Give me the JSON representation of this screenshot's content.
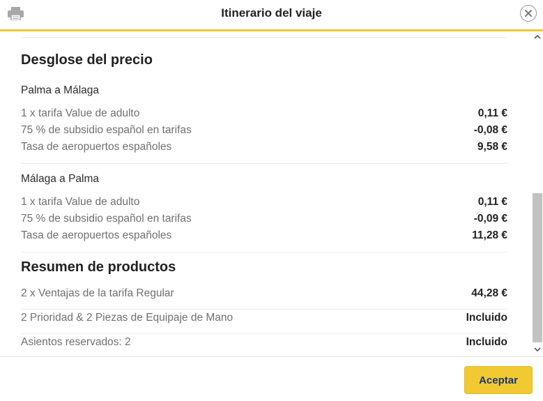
{
  "header": {
    "title": "Itinerario del viaje",
    "print_icon": "printer-icon",
    "close_icon": "close-icon"
  },
  "price_breakdown": {
    "heading": "Desglose del precio",
    "segments": [
      {
        "route": "Palma a Málaga",
        "lines": [
          {
            "label": "1 x tarifa Value de adulto",
            "amount": "0,11 €"
          },
          {
            "label": "75 % de subsidio español en tarifas",
            "amount": "-0,08 €"
          },
          {
            "label": "Tasa de aeropuertos españoles",
            "amount": "9,58 €"
          }
        ]
      },
      {
        "route": "Málaga a Palma",
        "lines": [
          {
            "label": "1 x tarifa Value de adulto",
            "amount": "0,11 €"
          },
          {
            "label": "75 % de subsidio español en tarifas",
            "amount": "-0,09 €"
          },
          {
            "label": "Tasa de aeropuertos españoles",
            "amount": "11,28 €"
          }
        ]
      }
    ]
  },
  "products_summary": {
    "heading": "Resumen de productos",
    "items": [
      {
        "label": "2 x Ventajas de la tarifa Regular",
        "amount": "44,28 €"
      },
      {
        "label": "2 Prioridad & 2 Piezas de Equipaje de Mano",
        "amount": "Incluido"
      },
      {
        "label": "Asientos reservados: 2",
        "amount": "Incluido"
      }
    ]
  },
  "footer": {
    "accept_label": "Aceptar"
  },
  "colors": {
    "accent": "#f1c933",
    "button_text": "#173479"
  }
}
